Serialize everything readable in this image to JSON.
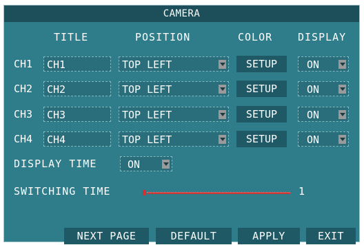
{
  "title": "CAMERA",
  "headers": {
    "title": "TITLE",
    "position": "POSITION",
    "color": "COLOR",
    "display": "DISPLAY"
  },
  "channels": [
    {
      "label": "CH1",
      "title_value": "CH1",
      "position": "TOP LEFT",
      "color_button": "SETUP",
      "display": "ON"
    },
    {
      "label": "CH2",
      "title_value": "CH2",
      "position": "TOP LEFT",
      "color_button": "SETUP",
      "display": "ON"
    },
    {
      "label": "CH3",
      "title_value": "CH3",
      "position": "TOP LEFT",
      "color_button": "SETUP",
      "display": "ON"
    },
    {
      "label": "CH4",
      "title_value": "CH4",
      "position": "TOP LEFT",
      "color_button": "SETUP",
      "display": "ON"
    }
  ],
  "display_time": {
    "label": "DISPLAY TIME",
    "value": "ON"
  },
  "switching_time": {
    "label": "SWITCHING TIME",
    "value": "1"
  },
  "buttons": {
    "next_page": "NEXT PAGE",
    "default": "DEFAULT",
    "apply": "APPLY",
    "exit": "EXIT"
  },
  "colors": {
    "background": "#2f7c8a",
    "title_bar": "#1c4f5a",
    "button": "#1f5966",
    "slider": "#c83a3a"
  }
}
